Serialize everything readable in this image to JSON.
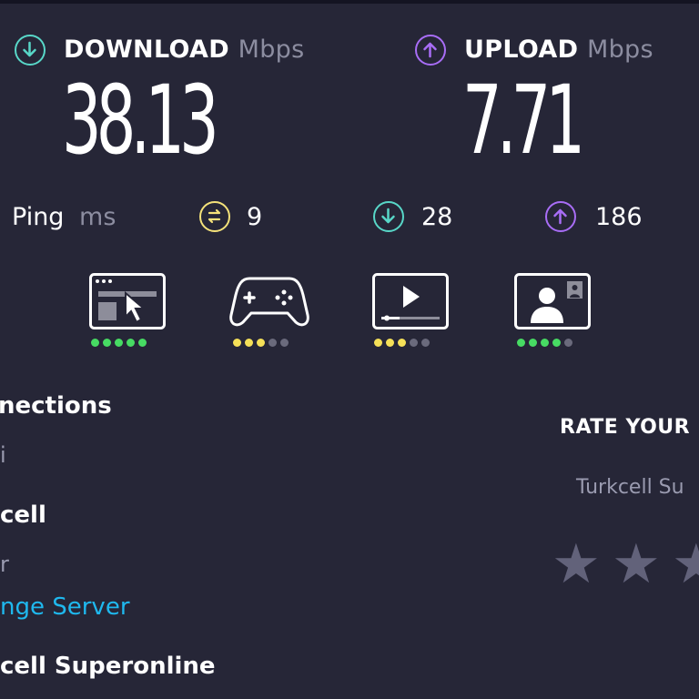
{
  "colors": {
    "background": "#262637",
    "download": "#58d7c8",
    "upload": "#a86df6",
    "ping": "#f5e27a",
    "good": "#47db63",
    "fair": "#f5e058",
    "inactive": "#6a6a7c",
    "link": "#1fb8ee"
  },
  "download": {
    "label": "DOWNLOAD",
    "unit": "Mbps",
    "value": "38.13",
    "icon": "arrow-down-circle-icon"
  },
  "upload": {
    "label": "UPLOAD",
    "unit": "Mbps",
    "value": "7.71",
    "icon": "arrow-up-circle-icon"
  },
  "ping": {
    "label": "Ping",
    "unit": "ms",
    "idle": "9",
    "download": "28",
    "upload": "186"
  },
  "quality": [
    {
      "name": "browsing",
      "icon": "browser-cursor-icon",
      "level": 5,
      "max": 5,
      "tone": "good"
    },
    {
      "name": "gaming",
      "icon": "gamepad-icon",
      "level": 3,
      "max": 5,
      "tone": "fair"
    },
    {
      "name": "streaming",
      "icon": "video-player-icon",
      "level": 3,
      "max": 5,
      "tone": "fair"
    },
    {
      "name": "video-call",
      "icon": "video-call-icon",
      "level": 4,
      "max": 5,
      "tone": "good"
    }
  ],
  "connections": {
    "title": "nections",
    "type": "i",
    "provider": "cell",
    "server_label": "r",
    "change_server": "nge Server",
    "server_name": "cell Superonline"
  },
  "rating": {
    "title": "RATE YOUR",
    "isp": "Turkcell Su",
    "stars": [
      "★",
      "★",
      "★"
    ]
  }
}
